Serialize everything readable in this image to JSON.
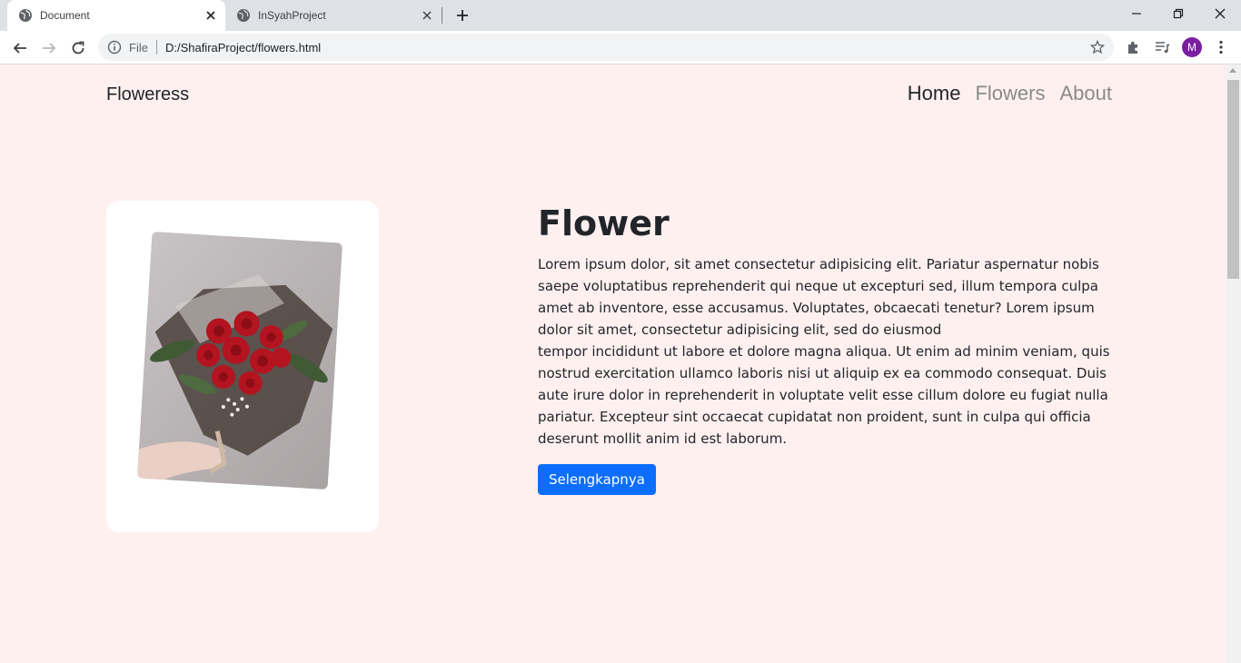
{
  "browser": {
    "tabs": [
      {
        "title": "Document",
        "active": true
      },
      {
        "title": "InSyahProject",
        "active": false
      }
    ],
    "url_scheme": "File",
    "url": "D:/ShafiraProject/flowers.html",
    "avatar_letter": "M",
    "avatar_color": "#7b1fa2"
  },
  "site": {
    "brand": "Floweress",
    "nav": [
      {
        "label": "Home",
        "active": true
      },
      {
        "label": "Flowers",
        "active": false
      },
      {
        "label": "About",
        "active": false
      }
    ]
  },
  "hero": {
    "heading": "Flower",
    "paragraph_1": "Lorem ipsum dolor, sit amet consectetur adipisicing elit. Pariatur aspernatur nobis saepe voluptatibus reprehenderit qui neque ut excepturi sed, illum tempora culpa amet ab inventore, esse accusamus. Voluptates, obcaecati tenetur? Lorem ipsum dolor sit amet, consectetur adipisicing elit, sed do eiusmod",
    "paragraph_2": "tempor incididunt ut labore et dolore magna aliqua. Ut enim ad minim veniam, quis nostrud exercitation ullamco laboris nisi ut aliquip ex ea commodo consequat. Duis aute irure dolor in reprehenderit in voluptate velit esse cillum dolore eu fugiat nulla pariatur. Excepteur sint occaecat cupidatat non proident, sunt in culpa qui officia deserunt mollit anim id est laborum.",
    "button_label": "Selengkapnya",
    "image_subject": "red-rose-bouquet"
  },
  "colors": {
    "page_bg": "#fff0f0",
    "primary": "#0d6efd"
  }
}
